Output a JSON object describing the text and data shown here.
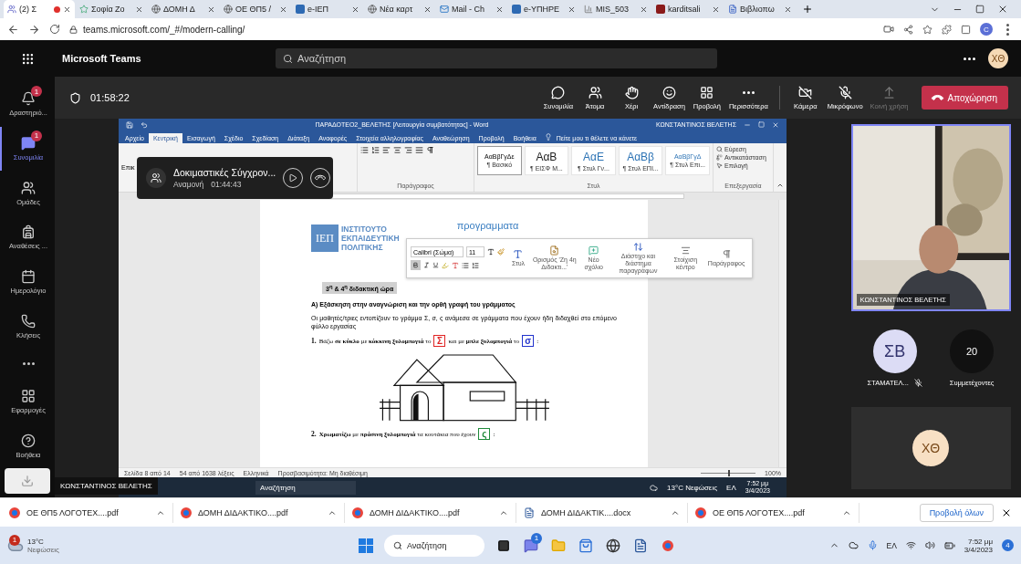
{
  "browser": {
    "tabs": [
      {
        "label": "(2) Σ",
        "kind": "teams",
        "selected": true,
        "recording": true
      },
      {
        "label": "Σοφία Ζο",
        "kind": "ninja",
        "selected": false,
        "recording": false
      },
      {
        "label": "ΔΟΜΗ Δ",
        "kind": "globe",
        "selected": false,
        "recording": false
      },
      {
        "label": "ΟΕ ΘΠ5 /",
        "kind": "globe",
        "selected": false,
        "recording": false
      },
      {
        "label": "e-ΙΕΠ",
        "kind": "site",
        "selected": false,
        "recording": false
      },
      {
        "label": "Νέα καρτ",
        "kind": "globe",
        "selected": false,
        "recording": false
      },
      {
        "label": "Mail - Ch",
        "kind": "mail",
        "selected": false,
        "recording": false
      },
      {
        "label": "e-ΥΠΗΡΕ",
        "kind": "site",
        "selected": false,
        "recording": false
      },
      {
        "label": "MIS_503",
        "kind": "chart",
        "selected": false,
        "recording": false
      },
      {
        "label": "karditsali",
        "kind": "brand",
        "selected": false,
        "recording": false
      },
      {
        "label": "Βιβλιοπω",
        "kind": "doc",
        "selected": false,
        "recording": false
      }
    ],
    "url": "teams.microsoft.com/_#/modern-calling/",
    "profile": "C"
  },
  "teams": {
    "app_name": "Microsoft Teams",
    "search_placeholder": "Αναζήτηση",
    "user_initials": "ΧΘ",
    "rail": [
      {
        "label": "Δραστηριό...",
        "kind": "bell",
        "badge": "1",
        "selected": false
      },
      {
        "label": "Συνομιλία",
        "kind": "chat",
        "badge": "1",
        "selected": true
      },
      {
        "label": "Ομάδες",
        "kind": "teams",
        "selected": false
      },
      {
        "label": "Αναθέσεις ...",
        "kind": "backpack",
        "selected": false
      },
      {
        "label": "Ημερολόγιο",
        "kind": "calendar",
        "selected": false
      },
      {
        "label": "Κλήσεις",
        "kind": "phone",
        "selected": false
      },
      {
        "kind": "more",
        "selected": false
      },
      {
        "label": "Εφαρμογές",
        "kind": "apps",
        "selected": false
      }
    ],
    "help": "Βοήθεια",
    "call": {
      "timer": "01:58:22",
      "actions": [
        {
          "label": "Συνομιλία",
          "kind": "chat",
          "off": false,
          "disabled": false
        },
        {
          "label": "Άτομα",
          "kind": "people",
          "off": false,
          "disabled": false
        },
        {
          "label": "Χέρι",
          "kind": "hand",
          "off": false,
          "disabled": false
        },
        {
          "label": "Αντίδραση",
          "kind": "smile",
          "off": false,
          "disabled": false
        },
        {
          "label": "Προβολή",
          "kind": "layout",
          "off": false,
          "disabled": false
        },
        {
          "label": "Περισσότερα",
          "kind": "more",
          "off": false,
          "disabled": false
        },
        {
          "label": "Κάμερα",
          "kind": "camera",
          "off": true,
          "disabled": false
        },
        {
          "label": "Μικρόφωνο",
          "kind": "mic",
          "off": true,
          "disabled": false
        },
        {
          "label": "Κοινή χρήση",
          "kind": "share",
          "off": false,
          "disabled": true
        }
      ],
      "leave": "Αποχώρηση"
    },
    "presenter": "ΚΩΝΣΤΑΝΤΙΝΟΣ ΒΕΛΕΤΗΣ",
    "video": {
      "name": "ΚΩΝΣΤΑΝΤΙΝΟΣ ΒΕΛΕΤΗΣ"
    },
    "participants": [
      {
        "initials": "ΣΒ",
        "name": "ΣΤΑΜΑΤΕΛ...",
        "muted": true
      }
    ],
    "participant_count": {
      "count": "20",
      "label": "Συμμετέχοντες"
    },
    "self_initials": "ΧΘ"
  },
  "word": {
    "title": "ΠΑΡΑΔΟΤΕΟ2_ΒΕΛΕΤΗΣ [Λειτουργία συμβατότητας] - Word",
    "user": "ΚΩΝΣΤΑΝΤΙΝΟΣ ΒΕΛΕΤΗΣ",
    "menu": [
      {
        "label": "Αρχείο",
        "selected": false
      },
      {
        "label": "Κεντρική",
        "selected": true
      },
      {
        "label": "Εισαγωγή",
        "selected": false
      },
      {
        "label": "Σχέδιο",
        "selected": false
      },
      {
        "label": "Σχεδίαση",
        "selected": false
      },
      {
        "label": "Διάταξη",
        "selected": false
      },
      {
        "label": "Αναφορές",
        "selected": false
      },
      {
        "label": "Στοιχεία αλληλογραφίας",
        "selected": false
      },
      {
        "label": "Αναθεώρηση",
        "selected": false
      },
      {
        "label": "Προβολή",
        "selected": false
      },
      {
        "label": "Βοήθεια",
        "selected": false
      }
    ],
    "tell_me": "Πείτε μου τι θέλετε να κάνετε",
    "clipboard_label": "Επικ",
    "groups": {
      "paragraph": "Παράγραφος",
      "styles": "Στυλ",
      "editing": "Επεξεργασία"
    },
    "styles": [
      {
        "sample": "ΑαΒβΓγΔε",
        "name": "¶ Βασικό",
        "selected": true
      },
      {
        "sample": "ΑαΒ",
        "name": "¶ ΕΙΣΦ Μ...",
        "selected": false
      },
      {
        "sample": "ΑαΕ",
        "name": "¶ Στυλ Γν...",
        "selected": false
      },
      {
        "sample": "ΑαΒβ",
        "name": "¶ Στυλ ΕΠΙ...",
        "selected": false
      },
      {
        "sample": "ΑαΒβΓγΔ",
        "name": "¶ Στυλ Επι...",
        "selected": false
      }
    ],
    "editing": [
      "Εύρεση",
      "Αντικατάσταση",
      "Επιλογή"
    ],
    "status": [
      "Σελίδα 8 από 14",
      "54 από 1638 λέξεις",
      "Ελληνικά",
      "Προσβασιμότητα: Μη διαθέσιμη"
    ],
    "zoom": {
      "label": "100%",
      "level": 0.5
    }
  },
  "teams_overlay": {
    "title": "Δοκιμαστικές Σύγχρον...",
    "status": "Αναμονή",
    "time": "01:44:43"
  },
  "document": {
    "logo_mark": "ΙΕΠ",
    "logo_lines": [
      "ΙΝΣΤΙΤΟΥΤΟ",
      "ΕΚΠΑΙΔΕΥΤΙΚΗ",
      "ΠΟΛΙΤΙΚΗΣ"
    ],
    "program_logo": "προγραμματα",
    "heading": "3$^{η}$ & 4$^{η}$ διδακτική ώρα",
    "subheading": "Α) Εξάσκηση στην αναγνώριση και την ορθή γραφή του γράμματος",
    "paragraph": "Οι μαθητές/τριες εντοπίζουν το  γράμμα Σ, σ, ς ανάμεσα σε γράμματα που έχουν ήδη διδαχθεί στο επόμενο φύλλο εργασίας",
    "tasks": [
      {
        "number": "1.",
        "parts": [
          {
            "kind": "text",
            "text": "Βάζω **σε κύκλο** με **κόκκινη ξυλομπογιά** το"
          },
          {
            "kind": "letter",
            "text": "Σ",
            "color": "#e02424"
          },
          {
            "kind": "text",
            "text": "και με **μπλε ξυλομπογιά** το"
          },
          {
            "kind": "letter",
            "text": "σ",
            "color": "#2233cc"
          },
          {
            "kind": "text",
            "text": ":"
          }
        ]
      },
      {
        "number": "2.",
        "parts": [
          {
            "kind": "text",
            "text": "**Χρωματίζω** με **πράσινη ξυλομπογιά** τα κουτάκια που έχουν"
          },
          {
            "kind": "letter",
            "text": "ς",
            "color": "#1f8a3a"
          },
          {
            "kind": "text",
            "text": ":"
          }
        ]
      }
    ]
  },
  "mini_toolbar": {
    "font": "Calibri (Σώμα)",
    "size": "11",
    "bold_selected": true,
    "buttons": [
      "Στυλ",
      "Ορισμός 'Ζη 4η Διδακτι...'",
      "Νέο σχόλιο",
      "Διάστιχο και διάστημα παραγράφων",
      "Στοίχιση κέντρο",
      "Παράγραφος"
    ]
  },
  "shared_taskbar": {
    "search": "Αναζήτηση",
    "weather": "13°C Νεφώσεις",
    "language": "ΕΛ",
    "time": "7:52 μμ",
    "date": "3/4/2023"
  },
  "downloads": {
    "items": [
      {
        "name": "ΟΕ ΘΠ5 ΛΟΓΟΤΕΧ....pdf",
        "kind": "pdf"
      },
      {
        "name": "ΔΟΜΗ ΔΙΔΑΚΤΙΚΟ....pdf",
        "kind": "pdf"
      },
      {
        "name": "ΔΟΜΗ ΔΙΔΑΚΤΙΚΟ....pdf",
        "kind": "pdf"
      },
      {
        "name": "ΔΟΜΗ ΔΙΔΑΚΤΙΚ....docx",
        "kind": "word"
      },
      {
        "name": "ΟΕ ΘΠ5 ΛΟΓΟΤΕΧ....pdf",
        "kind": "pdf"
      }
    ],
    "show_all": "Προβολή όλων"
  },
  "taskbar": {
    "weather": {
      "temp": "13°C",
      "text": "Νεφώσεις",
      "badge": "1"
    },
    "search": "Αναζήτηση",
    "apps": [
      {
        "kind": "taskview"
      },
      {
        "kind": "teams",
        "badge": "1"
      },
      {
        "kind": "folder"
      },
      {
        "kind": "store"
      },
      {
        "kind": "dell"
      },
      {
        "kind": "word"
      },
      {
        "kind": "chrome"
      }
    ],
    "language": "ΕΛ",
    "time": "7:52 μμ",
    "date": "3/4/2023",
    "notifications": "4"
  }
}
